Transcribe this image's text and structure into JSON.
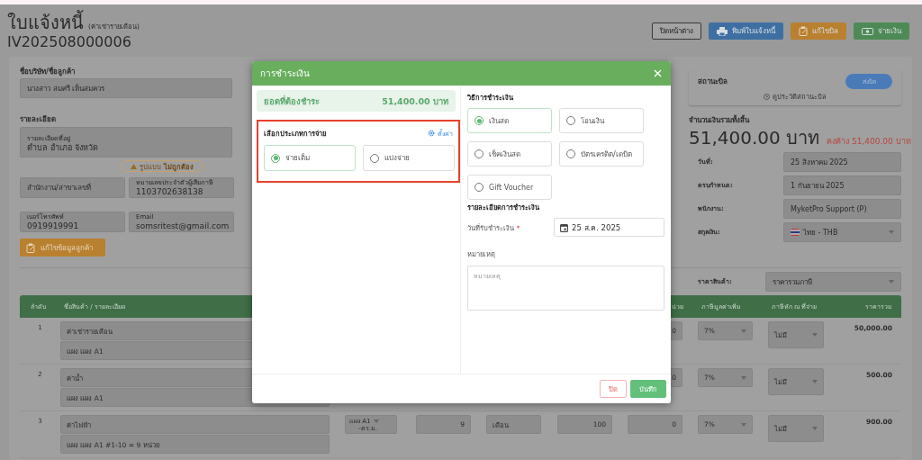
{
  "page_header": {
    "title": "ใบแจ้งหนี้",
    "subtitle": "(ค่าเช่ารายเดือน)",
    "document_number": "IV202508000006"
  },
  "toolbar": [
    {
      "label": "ปิดหน้าต่าง",
      "kind": "outline"
    },
    {
      "label": "พิมพ์ใบแจ้งหนี้",
      "kind": "print"
    },
    {
      "label": "แก้ไขบิล",
      "kind": "edit"
    },
    {
      "label": "จ่ายเงิน",
      "kind": "pay"
    }
  ],
  "customer": {
    "name_label": "ชื่อบริษัท/ชื่อลูกค้า",
    "name": "นางสาว สมศรี เห็นสมควร",
    "details_label": "รายละเอียด",
    "address": {
      "label": "รายละเอียดที่อยู่",
      "value": "ตำบล อำเภอ จังหวัด"
    },
    "warning_badge": "รูปแบบ **ไม่ถูกต้อง**",
    "branch": {
      "placeholder": "สำนักงาน/สาขาเลขที่"
    },
    "tax_id": {
      "label": "หมายเลขประจำตัวผู้เสียภาษี",
      "value": "1103702638138"
    },
    "phone": {
      "label": "เบอร์โทรศัพท์",
      "value": "0919919991"
    },
    "email": {
      "label": "Email",
      "value": "somsritest@gmail.com"
    },
    "edit_button": "แก้ไขข้อมูลลูกค้า"
  },
  "bill": {
    "status_label": "สถานะบิล",
    "status_button": "ส่งบิล",
    "history_link": "ดูประวัติสถานะบิล",
    "total_label": "จำนวนเงินรวมทั้งสิ้น",
    "total": "51,400.00 บาท",
    "outstanding": "คงค้าง 51,400.00 บาท",
    "fields": [
      {
        "label": "วันที่:",
        "value": "25 สิงหาคม 2025",
        "kind": "text"
      },
      {
        "label": "ครบกำหนด:",
        "value": "1 กันยายน 2025",
        "kind": "text"
      },
      {
        "label": "พนักงาน:",
        "value": "MyketPro Support (P)",
        "kind": "text"
      },
      {
        "label": "สกุลเงิน:",
        "value": "ไทย - THB",
        "kind": "currency"
      }
    ],
    "price_type": {
      "label": "ราคาสินค้า:",
      "value": "ราคารวมภาษี"
    }
  },
  "table": {
    "columns": {
      "index": "ลำดับ",
      "item": "ชื่อสินค้า / รายละเอียด",
      "column_7": "น่วย",
      "vat": "ภาษีมูลค่าเพิ่ม",
      "withholding_tax": "ภาษีหัก ณ ที่จ่าย",
      "total": "ราคารวม"
    },
    "rows": [
      {
        "number": "1",
        "name": "ค่าเช่ารายเดือน",
        "detail": "แผง แผง A1",
        "discount": "0",
        "vat": "7%",
        "withholding_tax": "ไม่มี",
        "total": "50,000.00"
      },
      {
        "number": "2",
        "name": "ค่าน้ำ",
        "detail": "แผง แผง A1",
        "discount": "0",
        "vat": "7%",
        "withholding_tax": "ไม่มี",
        "total": "500.00"
      },
      {
        "number": "3",
        "name": "ค่าไฟฟ้า",
        "detail": "แผง แผง A1 #1-10 = 9 หน่วย",
        "zone": "แผง A1",
        "zone_note": "-ตร.ม.",
        "quantity": "9",
        "unit": "เดือน",
        "price": "100",
        "discount": "0",
        "vat": "7%",
        "withholding_tax": "ไม่มี",
        "total": "900.00"
      }
    ]
  },
  "modal": {
    "title": "การชำระเงิน",
    "amount_label": "ยอดที่ต้องชำระ",
    "amount": "51,400.00 บาท",
    "payment_type": {
      "title": "เลือกประเภทการจ่าย",
      "settings_link": "ตั้งค่า",
      "highlighted": true,
      "options": [
        {
          "label": "จ่ายเต็ม",
          "selected": true
        },
        {
          "label": "แบ่งจ่าย",
          "selected": false
        }
      ]
    },
    "payment_method": {
      "title": "วิธีการชำระเงิน",
      "options": [
        {
          "label": "เงินสด",
          "selected": true
        },
        {
          "label": "โอนเงิน",
          "selected": false
        },
        {
          "label": "เช็คเงินสด",
          "selected": false
        },
        {
          "label": "บัตรเครดิต/เดบิต",
          "selected": false
        },
        {
          "label": "Gift Voucher",
          "selected": false
        }
      ]
    },
    "details": {
      "title": "รายละเอียดการชำระเงิน",
      "date_label": "วันที่รับชำระเงิน",
      "required": true,
      "required_mark": "*",
      "date": "25 ส.ค. 2025",
      "note_label": "หมายเหตุ",
      "note_placeholder": "หมายเหตุ"
    },
    "buttons": [
      {
        "label": "ปิด",
        "kind": "cancel"
      },
      {
        "label": "บันทึก",
        "kind": "save"
      }
    ]
  }
}
